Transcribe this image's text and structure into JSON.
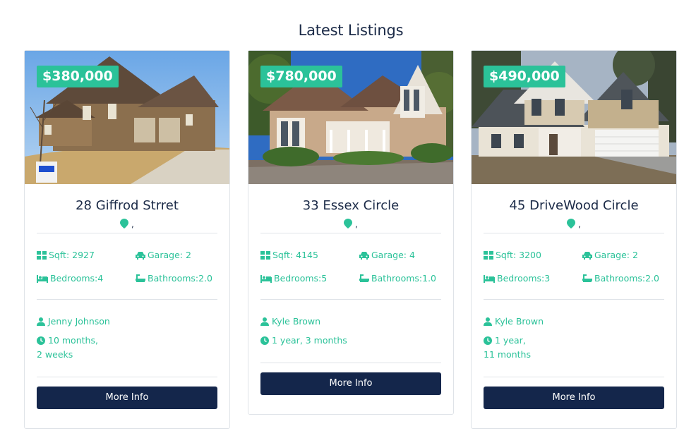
{
  "section_title": "Latest Listings",
  "colors": {
    "accent": "#2bc299",
    "button": "#14264b",
    "heading": "#1b2a47",
    "border": "#dfe3e8"
  },
  "listings": [
    {
      "price": "$380,000",
      "address": "28 Giffrod Strret",
      "location": ",",
      "sqft": "Sqft: 2927",
      "garage": "Garage: 2",
      "bedrooms": "Bedrooms:4",
      "bathrooms": "Bathrooms:2.0",
      "agent": "Jenny Johnson",
      "listed_line1": "10 months,",
      "listed_line2": "2 weeks",
      "button_label": "More Info"
    },
    {
      "price": "$780,000",
      "address": "33 Essex Circle",
      "location": ",",
      "sqft": "Sqft: 4145",
      "garage": "Garage: 4",
      "bedrooms": "Bedrooms:5",
      "bathrooms": "Bathrooms:1.0",
      "agent": "Kyle Brown",
      "listed_line1": "1 year, 3 months",
      "listed_line2": "",
      "button_label": "More Info"
    },
    {
      "price": "$490,000",
      "address": "45 DriveWood Circle",
      "location": ",",
      "sqft": "Sqft: 3200",
      "garage": "Garage: 2",
      "bedrooms": "Bedrooms:3",
      "bathrooms": "Bathrooms:2.0",
      "agent": "Kyle Brown",
      "listed_line1": "1 year,",
      "listed_line2": "11 months",
      "button_label": "More Info"
    }
  ]
}
